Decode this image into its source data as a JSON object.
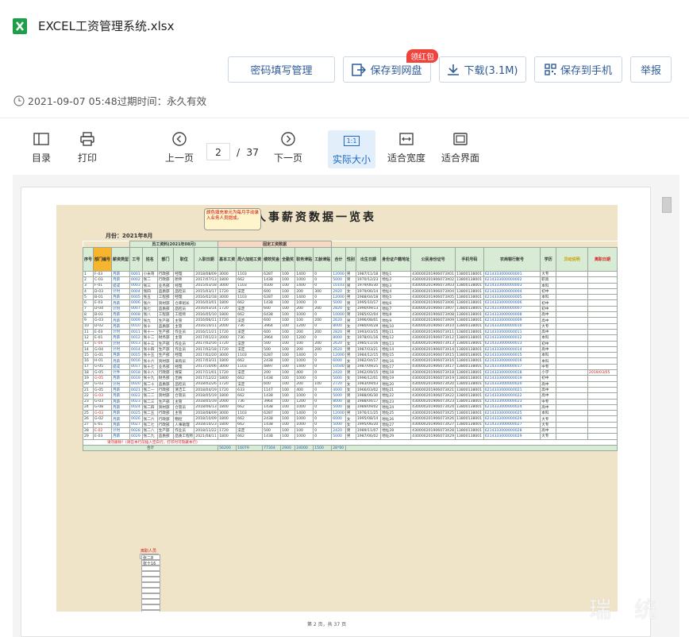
{
  "file": {
    "name": "EXCEL工资管理系统.xlsx"
  },
  "actions": {
    "password": "密码填写管理",
    "save_cloud": "保存到网盘",
    "badge": "领红包",
    "download": "下载(3.1M)",
    "save_phone": "保存到手机",
    "report": "举报"
  },
  "meta": {
    "date_expiry": "2021-09-07 05:48过期时间：永久有效"
  },
  "toolbar": {
    "toc": "目录",
    "print": "打印",
    "prev": "上一页",
    "page_current": "2",
    "page_sep": "/",
    "page_total": "37",
    "next": "下一页",
    "actual_size": "实际大小",
    "actual_icon": "1:1",
    "fit_width": "适合宽度",
    "fit_page": "适合界面"
  },
  "sheet": {
    "title": "人事薪资数据一览表",
    "month": "月份：2021年8月",
    "note": "颜色填充单元为每月手动录入业务人员提成。",
    "group_basic": "员工资料(2021年08月)",
    "group_salary": "固定工资数据",
    "headers": [
      "序号",
      "部门编号",
      "薪资类型",
      "工号",
      "姓名",
      "部门",
      "职位",
      "入职日期",
      "基本工资",
      "周六加班工资",
      "绩效奖金",
      "全勤奖",
      "职务津贴",
      "工龄津贴",
      "合计",
      "性别",
      "出生日期",
      "身份证户籍地址",
      "公民身份证号",
      "手机号码",
      "农商银行账号",
      "学历",
      "异动说明",
      "离职日期"
    ],
    "rows": [
      [
        "1",
        "F-03",
        "月薪",
        "0001",
        "小米哥",
        "行政部",
        "经理",
        "2018/08/09",
        "3000",
        "1103",
        "6287",
        "100",
        "1400",
        "0",
        "12000",
        "男",
        "1987/11/18",
        "地址1",
        "430000201906073X01",
        "13800138001",
        "6214333000000001",
        "大专",
        "",
        ""
      ],
      [
        "2",
        "C-03",
        "月薪",
        "0002",
        "张二",
        "行政部",
        "厨师",
        "2017/07/13",
        "1800",
        "662",
        "1438",
        "100",
        "1000",
        "0",
        "5000",
        "男",
        "1970/12/23",
        "地址2",
        "430000201906073X02",
        "13800138001",
        "6214333000000002",
        "职高",
        "",
        ""
      ],
      [
        "3",
        "F-01",
        "提成",
        "0003",
        "张三",
        "业务部",
        "经理",
        "2015/03/18",
        "3000",
        "1103",
        "4500",
        "100",
        "1400",
        "0",
        "10103",
        "男",
        "1979/06/30",
        "地址3",
        "430000201906073X03",
        "13800138001",
        "6214333000000003",
        "本科",
        "",
        ""
      ],
      [
        "4",
        "D-03",
        "计时",
        "0004",
        "张四",
        "品质部",
        "品检员",
        "2015/03/17",
        "1720",
        "法定",
        "600",
        "100",
        "200",
        "300",
        "2920",
        "女",
        "1979/06/14",
        "地址4",
        "430000201906073X04",
        "13800138001",
        "6214333000000004",
        "初中",
        "",
        ""
      ],
      [
        "5",
        "B-01",
        "月薪",
        "0005",
        "张五",
        "工程部",
        "经理",
        "2016/02/18",
        "3000",
        "1103",
        "6287",
        "100",
        "1400",
        "0",
        "12000",
        "男",
        "1988/04/18",
        "地址5",
        "430000201906073X05",
        "13800138001",
        "6214333000000005",
        "本科",
        "",
        ""
      ],
      [
        "6",
        "E-03",
        "月薪",
        "0006",
        "张六",
        "资材部",
        "仓库组长",
        "2016/03/01",
        "1800",
        "662",
        "1438",
        "100",
        "1000",
        "0",
        "5000",
        "男",
        "1995/10/17",
        "地址6",
        "430000201906073X06",
        "13800138001",
        "6214333000000006",
        "初中",
        "",
        ""
      ],
      [
        "7",
        "D-04",
        "计时",
        "0007",
        "张七",
        "品质部",
        "品检员",
        "2016/03/14",
        "1720",
        "法定",
        "600",
        "100",
        "200",
        "200",
        "2820",
        "女",
        "1990/09/13",
        "地址7",
        "430000201906073X07",
        "13800138001",
        "6214333000000007",
        "初中",
        "",
        ""
      ],
      [
        "8",
        "B-03",
        "月薪",
        "0008",
        "张八",
        "工程部",
        "工程师",
        "2016/05/10",
        "1800",
        "662",
        "6438",
        "100",
        "1000",
        "0",
        "10000",
        "男",
        "1985/02/04",
        "地址8",
        "430000201906073X08",
        "13800138001",
        "6214333000000008",
        "高中",
        "",
        ""
      ],
      [
        "9",
        "G-03",
        "月薪",
        "0009",
        "张九",
        "生产部",
        "主管",
        "2016/06/11",
        "1720",
        "法定",
        "600",
        "100",
        "100",
        "200",
        "2620",
        "男",
        "1996/08/01",
        "地址9",
        "430000201906073X09",
        "13800138001",
        "6214333000000009",
        "高中",
        "",
        ""
      ],
      [
        "10",
        "D-02",
        "月薪",
        "0010",
        "张十",
        "品质部",
        "主管",
        "2016/10/11",
        "2000",
        "736",
        "3964",
        "100",
        "1200",
        "0",
        "8000",
        "女",
        "1980/04/28",
        "地址10",
        "430000201906073X10",
        "13800138001",
        "6214333000000010",
        "大专",
        "",
        ""
      ],
      [
        "11",
        "E-03",
        "计时",
        "0011",
        "张十一",
        "生产部",
        "作业员",
        "2016/11/21",
        "1720",
        "法定",
        "600",
        "100",
        "200",
        "200",
        "2820",
        "男",
        "1993/03/15",
        "地址11",
        "430000201906073X11",
        "13800138001",
        "6214333000000011",
        "高中",
        "",
        ""
      ],
      [
        "12",
        "E-01",
        "月薪",
        "0012",
        "张十二",
        "财务部",
        "主管",
        "2017/01/23",
        "2000",
        "736",
        "3964",
        "100",
        "1200",
        "0",
        "8000",
        "女",
        "1978/01/16",
        "地址12",
        "430000201906073X12",
        "13800138001",
        "6214333000000012",
        "本科",
        "",
        ""
      ],
      [
        "13",
        "E-04",
        "计时",
        "0013",
        "张十三",
        "生产部",
        "作业员",
        "2017/02/16",
        "1720",
        "法定",
        "500",
        "100",
        "100",
        "200",
        "2620",
        "女",
        "1985/11/16",
        "地址13",
        "430000201906073X13",
        "13800138001",
        "6214333000000013",
        "初中",
        "",
        ""
      ],
      [
        "14",
        "G-04",
        "计时",
        "0014",
        "张十四",
        "生产部",
        "作业员",
        "2017/02/18",
        "1720",
        "法定",
        "500",
        "100",
        "200",
        "200",
        "2620",
        "男",
        "1987/03/21",
        "地址14",
        "430000201906073X14",
        "13800138001",
        "6214333000000014",
        "高中",
        "",
        ""
      ],
      [
        "15",
        "G-01",
        "月薪",
        "0015",
        "张十五",
        "生产部",
        "经理",
        "2017/02/20",
        "3000",
        "1103",
        "6287",
        "100",
        "1400",
        "0",
        "12000",
        "男",
        "1984/12/15",
        "地址15",
        "430000201906073X15",
        "13800138001",
        "6214333000000015",
        "本科",
        "",
        ""
      ],
      [
        "16",
        "H-01",
        "月薪",
        "0016",
        "张十六",
        "资材部",
        "采购员",
        "2017/03/31",
        "1800",
        "662",
        "2438",
        "100",
        "1000",
        "0",
        "6000",
        "女",
        "1982/04/17",
        "地址16",
        "430000201906073X16",
        "13800138001",
        "6214333000000016",
        "本科",
        "",
        ""
      ],
      [
        "17",
        "G-05",
        "提成",
        "0017",
        "张十七",
        "业务部",
        "经理",
        "2017/10/06",
        "3000",
        "1103",
        "4897",
        "100",
        "1400",
        "0",
        "10500",
        "男",
        "1987/09/25",
        "地址17",
        "430000201906073X17",
        "13800138001",
        "6214333000000017",
        "中专",
        "",
        ""
      ],
      [
        "18",
        "G-05",
        "计件",
        "0018",
        "张十八",
        "行政部",
        "保安",
        "2017/11/01",
        "1720",
        "法定",
        "200",
        "100",
        "400",
        "0",
        "2420",
        "男",
        "1962/09/15",
        "地址18",
        "430000201906073X18",
        "13800138001",
        "6214333000000018",
        "小学",
        "",
        "2019/03/05"
      ],
      [
        "19",
        "G-05",
        "月薪",
        "0019",
        "张十九",
        "财务部",
        "出纳",
        "2017/12/22",
        "1800",
        "662",
        "1438",
        "100",
        "1000",
        "0",
        "5000",
        "女",
        "1996/12/01",
        "地址19",
        "430000201906073X19",
        "13800138001",
        "6214333000000019",
        "初中",
        "",
        ""
      ],
      [
        "20",
        "G-03",
        "计时",
        "0020",
        "张二十",
        "品质部",
        "品检员",
        "2018/02/26",
        "1720",
        "法定",
        "600",
        "100",
        "200",
        "100",
        "2720",
        "女",
        "1983/09/03",
        "地址20",
        "430000201906073X20",
        "13800138001",
        "6214333000000020",
        "高中",
        "",
        ""
      ],
      [
        "21",
        "G-05",
        "月薪",
        "0021",
        "张二一",
        "行政部",
        "清洁工",
        "2018/04/19",
        "1720",
        "633",
        "1147",
        "100",
        "400",
        "0",
        "4000",
        "女",
        "1966/03/02",
        "地址21",
        "430000201906073X21",
        "13800138001",
        "6214333000000021",
        "高中",
        "",
        ""
      ],
      [
        "22",
        "G-03",
        "月薪",
        "0022",
        "张二二",
        "资材部",
        "仓管员",
        "2018/05/19",
        "1800",
        "662",
        "1438",
        "100",
        "1000",
        "0",
        "5000",
        "男",
        "1988/06/30",
        "地址22",
        "430000201906073X22",
        "13800138001",
        "6214333000000022",
        "高中",
        "",
        ""
      ],
      [
        "23",
        "G-03",
        "月薪",
        "0023",
        "张二三",
        "生产部",
        "主管",
        "2018/05/19",
        "2000",
        "736",
        "3964",
        "100",
        "1200",
        "0",
        "8000",
        "男",
        "1988/04/17",
        "地址23",
        "430000201906073X23",
        "13800138001",
        "6214333000000023",
        "中专",
        "",
        ""
      ],
      [
        "24",
        "G-08",
        "月薪",
        "0024",
        "张二四",
        "资材部",
        "仓管员",
        "2018/06/13",
        "1800",
        "662",
        "1438",
        "100",
        "1000",
        "0",
        "5000",
        "男",
        "1989/09/02",
        "地址24",
        "430000201906073X24",
        "13800138001",
        "6214333000000024",
        "高中",
        "",
        ""
      ],
      [
        "25",
        "G-03",
        "月薪",
        "0025",
        "张二五",
        "行政部",
        "主管",
        "2018/08/09",
        "3000",
        "1103",
        "6287",
        "100",
        "1400",
        "0",
        "12000",
        "男",
        "1976/11/25",
        "地址25",
        "430000201906073X25",
        "13800138001",
        "6214333000000025",
        "本科",
        "",
        ""
      ],
      [
        "26",
        "G-02",
        "月薪",
        "0026",
        "张二六",
        "行政部",
        "物控",
        "2018/10/09",
        "1800",
        "662",
        "2438",
        "100",
        "1000",
        "0",
        "6000",
        "女",
        "1995/08/14",
        "地址26",
        "430000201906073X26",
        "13800138001",
        "6214333000000026",
        "大专",
        "",
        ""
      ],
      [
        "27",
        "E-01",
        "月薪",
        "0027",
        "张二七",
        "行政部",
        "人事助理",
        "2018/10/23",
        "1800",
        "662",
        "1438",
        "100",
        "1000",
        "0",
        "5000",
        "女",
        "1995/06/20",
        "地址27",
        "430000201906073X27",
        "13800138001",
        "6214333000000027",
        "大专",
        "",
        ""
      ],
      [
        "28",
        "E-02",
        "计时",
        "0028",
        "张二八",
        "生产部",
        "作业员",
        "2018/11/22",
        "1720",
        "法定",
        "500",
        "100",
        "100",
        "0",
        "2420",
        "男",
        "1989/11/07",
        "地址28",
        "430000201906073X28",
        "13800138001",
        "6214333000000028",
        "高中",
        "",
        ""
      ],
      [
        "29",
        "E-03",
        "月薪",
        "0029",
        "张二九",
        "品质部",
        "品质工程师",
        "2021/08/11",
        "1800",
        "662",
        "1438",
        "100",
        "1000",
        "0",
        "5000",
        "男",
        "1987/06/02",
        "地址29",
        "430000201906073X29",
        "13800138001",
        "6214333000000029",
        "大专",
        "",
        ""
      ]
    ],
    "warn_text": "请勿删除！(请在本行前插入空白行，打印时可隐藏本行)",
    "sum_label": "合计",
    "sum_values": [
      "56200",
      "16079",
      "77304",
      "2900",
      "24000",
      "1500",
      "28*00"
    ],
    "side_title": "离职人员",
    "side_items": [
      "张二8",
      "张十16"
    ],
    "page_footer": "第 2 页，共 37 页"
  },
  "watermark": "瑞 统"
}
